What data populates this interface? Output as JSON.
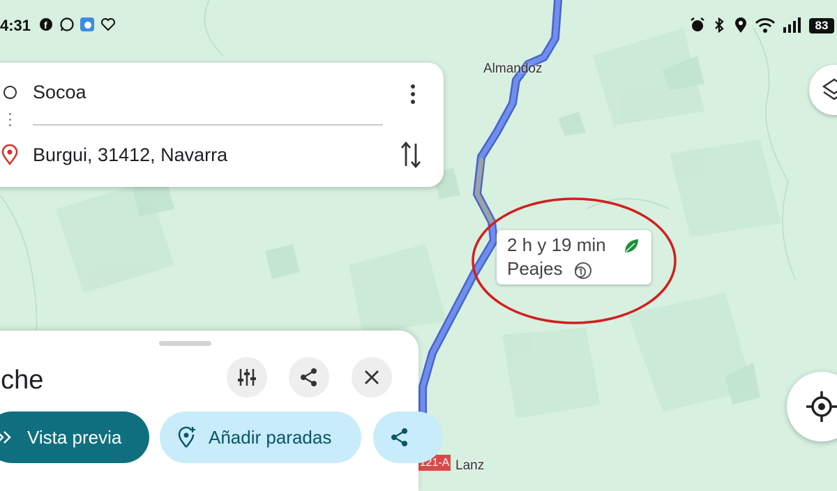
{
  "status_bar": {
    "time": "4:31",
    "battery": "83",
    "left_icons": [
      "facebook-icon",
      "whatsapp-icon",
      "weather-icon",
      "heart-icon"
    ],
    "right_icons": [
      "alarm-icon",
      "bluetooth-icon",
      "location-icon",
      "wifi-icon",
      "signal-icon"
    ]
  },
  "directions": {
    "origin": "Socoa",
    "destination": "Burgui, 31412, Navarra"
  },
  "map": {
    "towns": {
      "almandoz": "Almandoz",
      "lanz": "Lanz"
    },
    "road_label": "121-A",
    "route_info": {
      "duration": "2 h y 19 min",
      "tolls": "Peajes"
    },
    "colors": {
      "route": "#6f8ff0",
      "annotation_circle": "#d21f1f",
      "land": "#d7f0e0",
      "eco_leaf": "#1e8e3e"
    }
  },
  "bottom_sheet": {
    "mode_title": "oche",
    "preview_label": "Vista previa",
    "add_stops_label": "Añadir paradas",
    "primary_color": "#0f6f7e",
    "secondary_color": "#c8ecfa"
  }
}
